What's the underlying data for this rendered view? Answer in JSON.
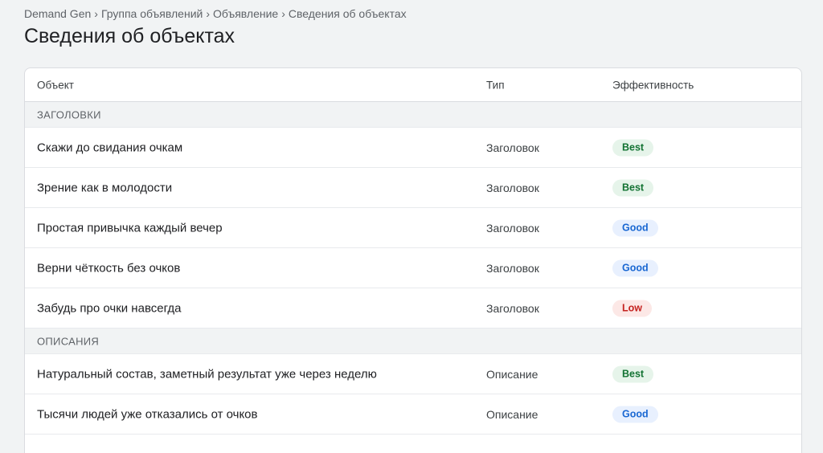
{
  "breadcrumb": {
    "items": [
      "Demand Gen",
      "Группа объявлений",
      "Объявление",
      "Сведения об объектах"
    ],
    "separator": "›"
  },
  "page_title": "Сведения об объектах",
  "table": {
    "columns": {
      "object": "Объект",
      "type": "Тип",
      "performance": "Эффективность"
    },
    "groups": [
      {
        "label": "ЗАГОЛОВКИ",
        "rows": [
          {
            "object": "Скажи до свидания очкам",
            "type": "Заголовок",
            "performance": "Best",
            "level": "best"
          },
          {
            "object": "Зрение как в молодости",
            "type": "Заголовок",
            "performance": "Best",
            "level": "best"
          },
          {
            "object": "Простая привычка каждый вечер",
            "type": "Заголовок",
            "performance": "Good",
            "level": "good"
          },
          {
            "object": "Верни чёткость без очков",
            "type": "Заголовок",
            "performance": "Good",
            "level": "good"
          },
          {
            "object": "Забудь про очки навсегда",
            "type": "Заголовок",
            "performance": "Low",
            "level": "low"
          }
        ]
      },
      {
        "label": "ОПИСАНИЯ",
        "rows": [
          {
            "object": "Натуральный состав, заметный результат уже через неделю",
            "type": "Описание",
            "performance": "Best",
            "level": "best"
          },
          {
            "object": "Тысячи людей уже отказались от очков",
            "type": "Описание",
            "performance": "Good",
            "level": "good"
          }
        ]
      }
    ]
  },
  "colors": {
    "best_bg": "#e6f4ea",
    "best_text": "#137333",
    "good_bg": "#e8f0fe",
    "good_text": "#1967d2",
    "low_bg": "#fce8e6",
    "low_text": "#c5221f"
  }
}
